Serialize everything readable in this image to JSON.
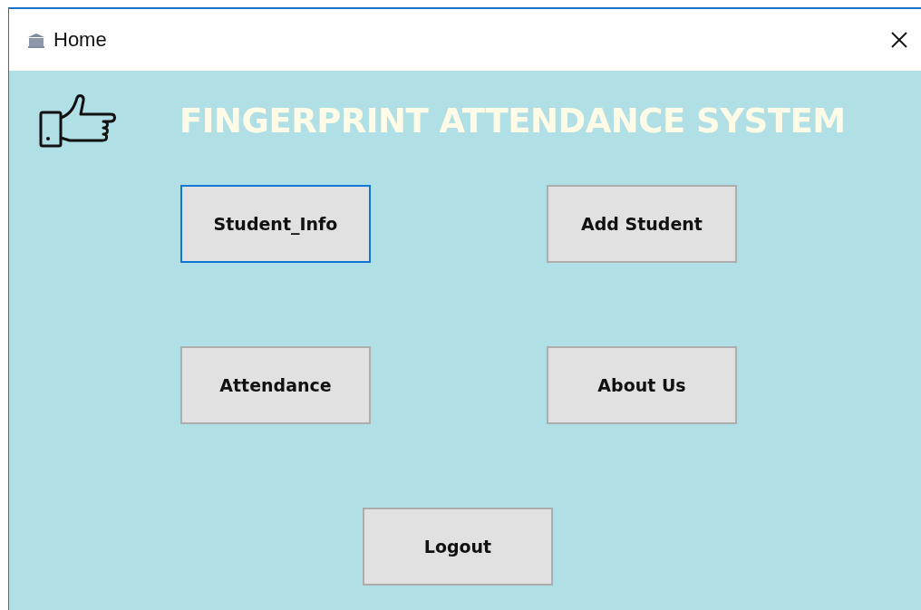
{
  "window": {
    "title": "Home"
  },
  "header": {
    "title": "FINGERPRINT ATTENDANCE SYSTEM"
  },
  "buttons": [
    {
      "label": "Student_Info",
      "focused": true
    },
    {
      "label": "Add Student",
      "focused": false
    },
    {
      "label": "Attendance",
      "focused": false
    },
    {
      "label": "About Us",
      "focused": false
    }
  ],
  "logout": {
    "label": "Logout",
    "focused": false
  }
}
